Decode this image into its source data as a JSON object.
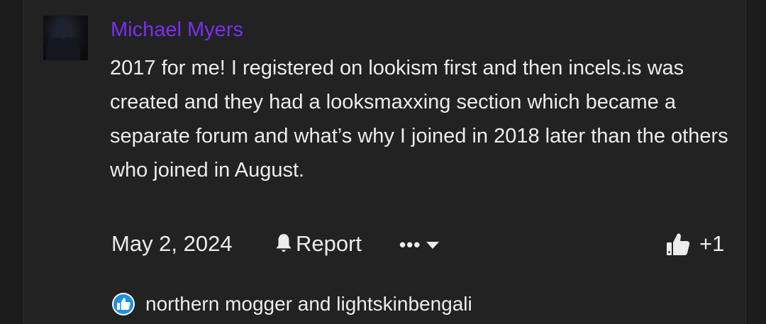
{
  "post": {
    "author": "Michael Myers",
    "message": "2017 for me! I registered on lookism first and then incels.is was created and they had a looksmaxxing section which became a separate forum and what’s why I joined in 2018 later than the others who joined in August.",
    "date": "May 2, 2024",
    "report_label": "Report",
    "more_label": "•••",
    "like_count": "+1",
    "reactions_text": "northern mogger and lightskinbengali"
  },
  "colors": {
    "background": "#222222",
    "author": "#7b2ff0",
    "text": "#ececec",
    "reaction_badge": "#1f8fe0"
  },
  "icons": {
    "report": "bell-icon",
    "more": "chevron-down-icon",
    "like": "thumbs-up-icon",
    "reaction": "like-reaction-icon"
  }
}
